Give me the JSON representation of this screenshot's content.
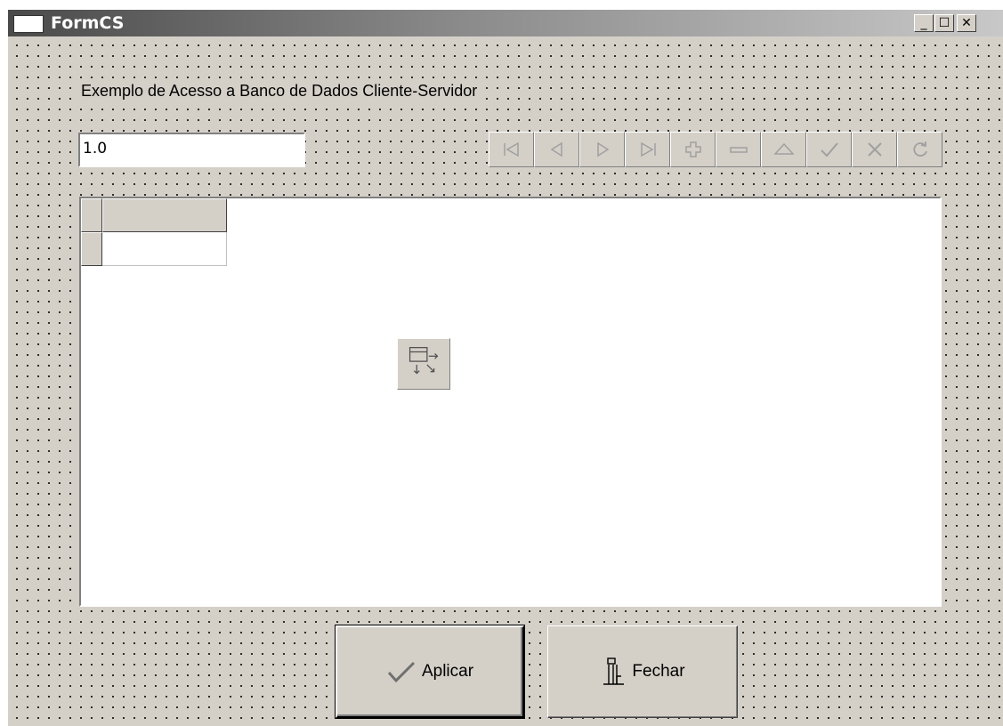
{
  "window": {
    "title": "FormCS",
    "minimize_glyph": "_",
    "maximize_glyph": "☐",
    "close_glyph": "✕"
  },
  "form": {
    "label": "Exemplo de Acesso a Banco de Dados Cliente-Servidor",
    "edit_value": "1.0"
  },
  "navigator": {
    "buttons": [
      {
        "icon": "first-record-icon"
      },
      {
        "icon": "prior-record-icon"
      },
      {
        "icon": "next-record-icon"
      },
      {
        "icon": "last-record-icon"
      },
      {
        "icon": "insert-record-icon"
      },
      {
        "icon": "delete-record-icon"
      },
      {
        "icon": "edit-record-icon"
      },
      {
        "icon": "post-record-icon"
      },
      {
        "icon": "cancel-record-icon"
      },
      {
        "icon": "refresh-record-icon"
      }
    ]
  },
  "buttons": {
    "apply_label": "Aplicar",
    "close_label": "Fechar"
  },
  "colors": {
    "face": "#d4d0c8",
    "disabled_glyph": "#a0a0a0"
  }
}
